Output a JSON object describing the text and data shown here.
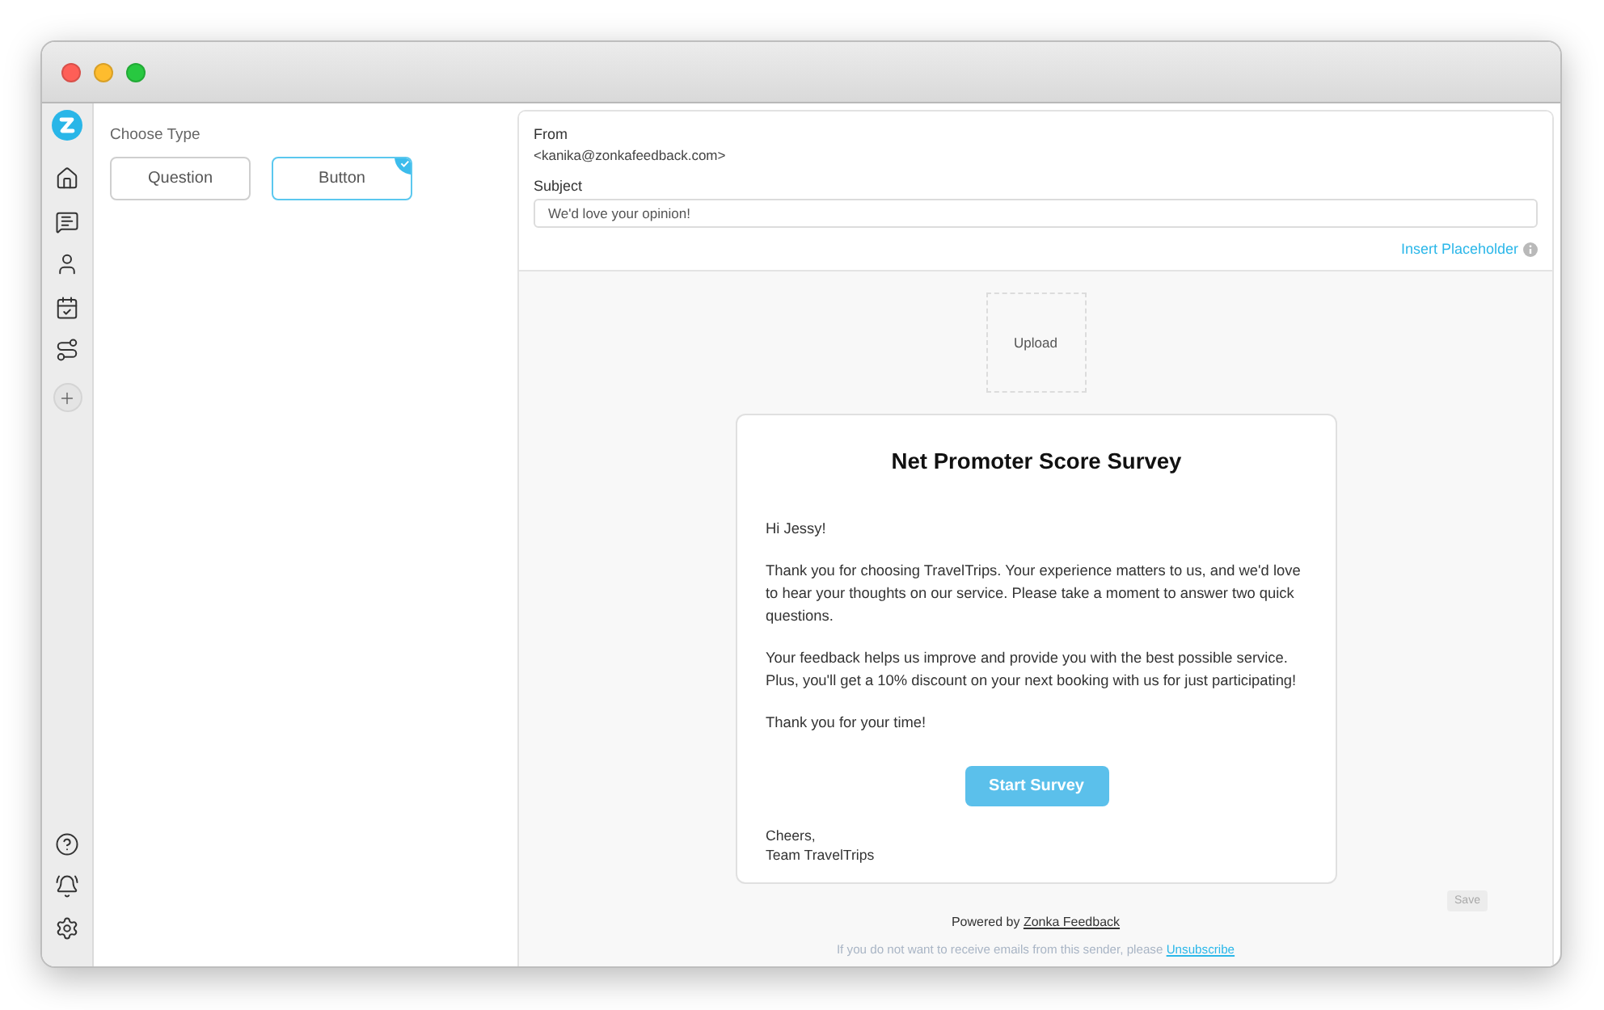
{
  "choose_type": {
    "label": "Choose Type",
    "options": [
      {
        "label": "Question",
        "selected": false
      },
      {
        "label": "Button",
        "selected": true
      }
    ]
  },
  "email_header": {
    "from_label": "From",
    "from_value": "<kanika@zonkafeedback.com>",
    "subject_label": "Subject",
    "subject_value": "We'd love your opinion!",
    "insert_placeholder": "Insert Placeholder"
  },
  "upload": {
    "label": "Upload"
  },
  "email": {
    "title": "Net Promoter Score Survey",
    "paragraphs": [
      "Hi Jessy!",
      "Thank you for choosing TravelTrips. Your experience matters to us, and we'd love to hear your thoughts on our service. Please take a moment to answer two quick questions.",
      "Your feedback helps us improve and provide you with the best possible service. Plus, you'll get a 10% discount on your next booking with us for just participating!",
      "Thank you for your time!"
    ],
    "button": "Start Survey",
    "signoff": [
      "Cheers,",
      "Team TravelTrips"
    ]
  },
  "save_button": {
    "label": "Save",
    "disabled": true
  },
  "footer": {
    "powered_by": "Powered by",
    "brand_link": "Zonka Feedback",
    "unsubscribe_text": "If you do not want to receive emails from this sender, please",
    "unsubscribe_link": "Unsubscribe"
  }
}
